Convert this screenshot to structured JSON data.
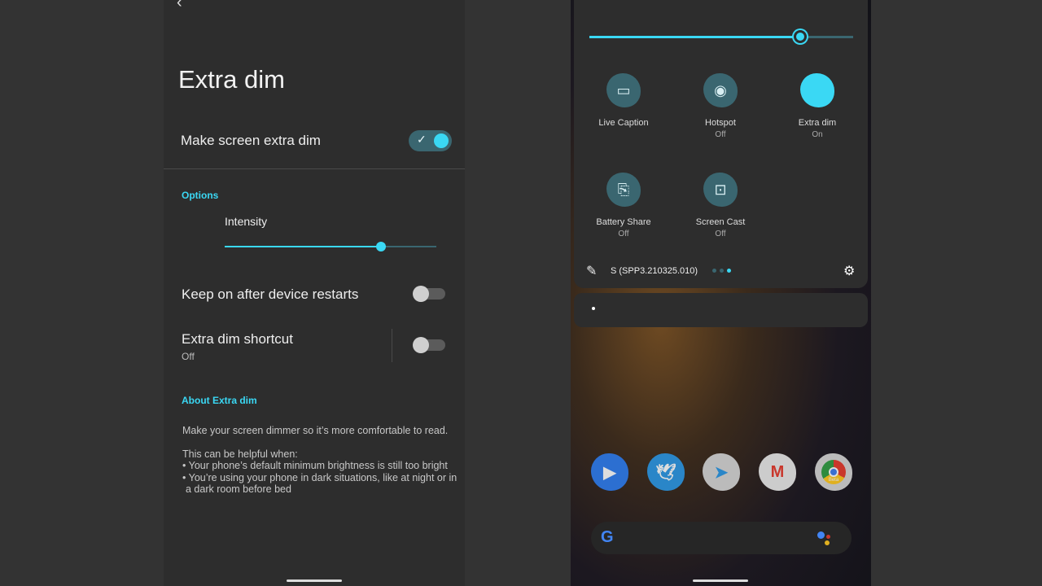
{
  "settings": {
    "title": "Extra dim",
    "main_toggle": {
      "label": "Make screen extra dim",
      "on": true
    },
    "options_header": "Options",
    "intensity": {
      "label": "Intensity",
      "value": 0.74
    },
    "keep_on": {
      "label": "Keep on after device restarts",
      "on": false
    },
    "shortcut": {
      "label": "Extra dim shortcut",
      "status": "Off",
      "on": false
    },
    "about_header": "About Extra dim",
    "about_intro": "Make your screen dimmer so it’s more comfortable to read.",
    "about_when": "This can be helpful when:",
    "about_bullet1": "• Your phone’s default minimum brightness is still too bright",
    "about_bullet2": "• You’re using your phone in dark situations, like at night or in",
    "about_bullet2b": "a dark room before bed"
  },
  "quick_settings": {
    "brightness": 0.8,
    "tiles": [
      {
        "label": "Live Caption",
        "status": "",
        "icon": "caption-icon",
        "on": false
      },
      {
        "label": "Hotspot",
        "status": "Off",
        "icon": "hotspot-icon",
        "on": false
      },
      {
        "label": "Extra dim",
        "status": "On",
        "icon": "extra-dim-icon",
        "on": true
      },
      {
        "label": "Battery Share",
        "status": "Off",
        "icon": "battery-share-icon",
        "on": false
      },
      {
        "label": "Screen Cast",
        "status": "Off",
        "icon": "cast-icon",
        "on": false
      }
    ],
    "build": "S (SPP3.210325.010)",
    "page_indicator": {
      "pages": 3,
      "current": 3
    }
  },
  "home": {
    "apps": [
      "Duo",
      "Twitter",
      "Telegram",
      "Gmail",
      "Chrome Beta"
    ],
    "chrome_badge": "Beta"
  },
  "colors": {
    "accent": "#3ad8f4",
    "accent_dim": "#3a6670"
  }
}
